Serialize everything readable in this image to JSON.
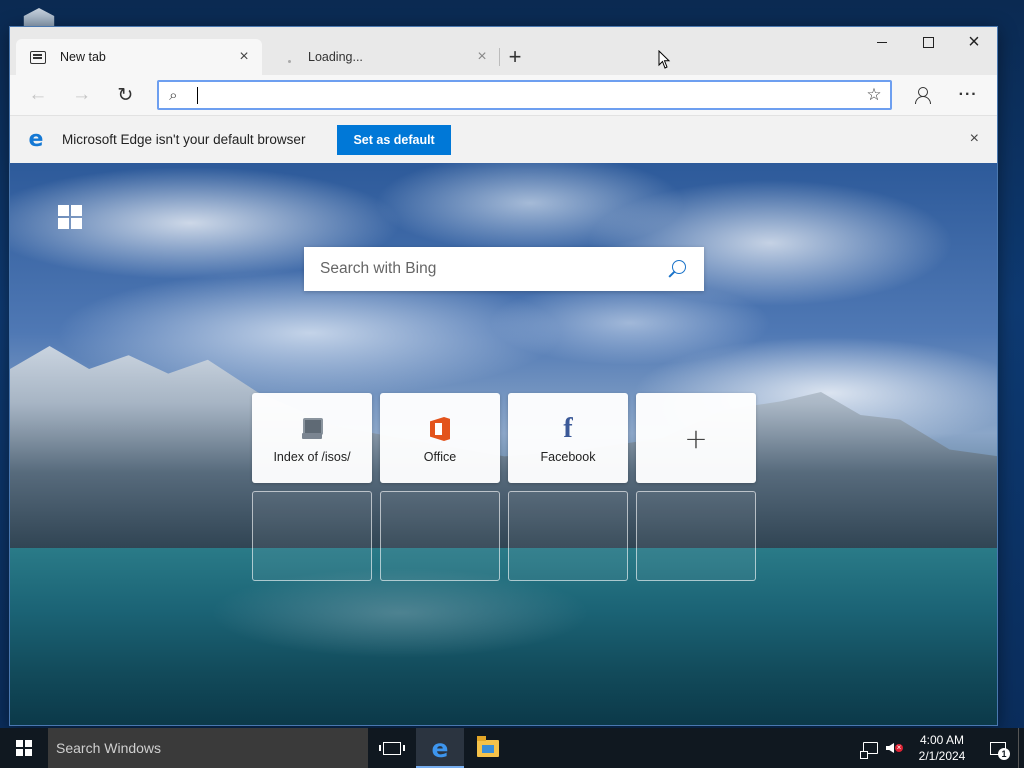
{
  "window": {
    "tabs": [
      {
        "label": "New tab",
        "icon": "new-tab-page-icon",
        "active": true
      },
      {
        "label": "Loading...",
        "icon": "loading-spinner-icon",
        "active": false
      }
    ],
    "new_tab_glyph": "+",
    "controls": {
      "minimize": "minimize-icon",
      "maximize": "maximize-icon",
      "close": "×"
    }
  },
  "toolbar": {
    "back_glyph": "←",
    "forward_glyph": "→",
    "refresh_glyph": "↻",
    "address_value": "",
    "search_glyph": "⌕",
    "favorite_glyph": "☆",
    "more_glyph": "···"
  },
  "infobar": {
    "logo_glyph": "e",
    "message": "Microsoft Edge isn't your default browser",
    "button_label": "Set as default",
    "close_glyph": "×"
  },
  "new_tab_page": {
    "search_placeholder": "Search with Bing",
    "quick_links": [
      {
        "label": "Index of /isos/",
        "icon": "computer-icon"
      },
      {
        "label": "Office",
        "icon": "office-icon"
      },
      {
        "label": "Facebook",
        "icon": "facebook-icon",
        "glyph": "f"
      },
      {
        "label": "",
        "icon": "plus-icon",
        "glyph": "+"
      }
    ]
  },
  "taskbar": {
    "search_placeholder": "Search Windows",
    "edge_glyph": "e",
    "time": "4:00 AM",
    "date": "2/1/2024",
    "notification_count": "1"
  },
  "colors": {
    "accent": "#0078d7",
    "address_border": "#6d9ff0",
    "taskbar": "#101820",
    "edge_blue": "#1478d4"
  }
}
